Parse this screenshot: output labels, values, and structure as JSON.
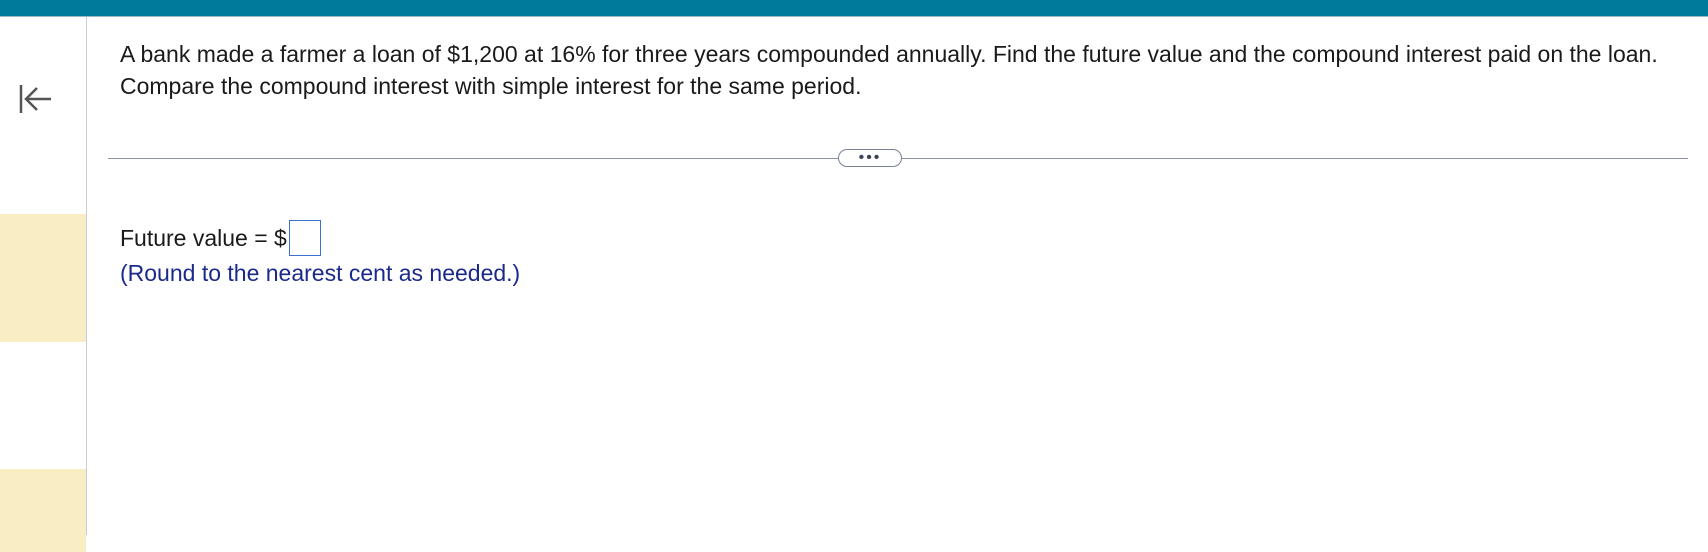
{
  "question": {
    "text": "A bank made a farmer a loan of $1,200 at 16% for three years compounded annually. Find the future value and the compound interest paid on the loan. Compare the compound interest with simple interest for the same period."
  },
  "sidebar": {
    "collapse_icon": "collapse-left-arrow-icon"
  },
  "divider": {
    "more_label": "•••"
  },
  "answer": {
    "label": "Future value = $",
    "input_value": "",
    "hint": "(Round to the nearest cent as needed.)"
  },
  "colors": {
    "topbar": "#007a9b",
    "highlight_band": "#f9edc3",
    "hint_text": "#1b2a8a",
    "input_border": "#3b6fd0"
  }
}
